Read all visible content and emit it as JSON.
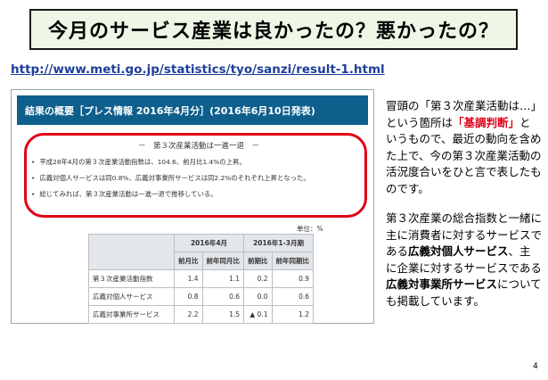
{
  "slide": {
    "title": "今月のサービス産業は良かったの？悪かったの？",
    "url": "http://www.meti.go.jp/statistics/tyo/sanzi/result-1.html",
    "page_number": "4"
  },
  "screenshot": {
    "header": "結果の概要［プレス情報 2016年4月分］(2016年6月10日発表)",
    "summary_title": "－　第３次産業活動は一進一退　－",
    "bullets": [
      "平成28年4月の第３次産業活動指数は、104.6、前月比1.4%の上昇。",
      "広義対個人サービスは同0.8%、広義対事業所サービスは同2.2%のそれぞれ上昇となった。",
      "総じてみれば、第３次産業活動は一進一退で推移している。"
    ],
    "unit": "単位：%",
    "table": {
      "period_headers": [
        "2016年4月",
        "2016年1-3月期"
      ],
      "sub_headers": [
        "前月比",
        "前年同月比",
        "前期比",
        "前年同期比"
      ],
      "rows": [
        {
          "label": "第３次産業活動指数",
          "values": [
            "1.4",
            "1.1",
            "0.2",
            "0.9"
          ]
        },
        {
          "label": "広義対個人サービス",
          "values": [
            "0.8",
            "0.6",
            "0.0",
            "0.6"
          ]
        },
        {
          "label": "広義対事業所サービス",
          "values": [
            "2.2",
            "1.5",
            "▲ 0.1",
            "1.2"
          ]
        }
      ]
    }
  },
  "sidebar": {
    "p1_a": "冒頭の「第３次産業活動は…」という箇所は",
    "p1_highlight": "「基調判断」",
    "p1_b": "というもので、最近の動向を含めた上で、今の第３次産業活動の活況度合いをひと言で表したものです。",
    "p2_a": "第３次産業の総合指数と一緒に主に消費者に対するサービスである",
    "p2_bold1": "広義対個人サービス",
    "p2_b": "、主に企業に対するサービスである",
    "p2_bold2": "広義対事業所サービス",
    "p2_c": "についても掲載しています。"
  },
  "colors": {
    "accent_red": "#e00016",
    "header_blue": "#0e5f8c",
    "title_bg": "#eef7e6",
    "link_blue": "#1f3f9a"
  }
}
